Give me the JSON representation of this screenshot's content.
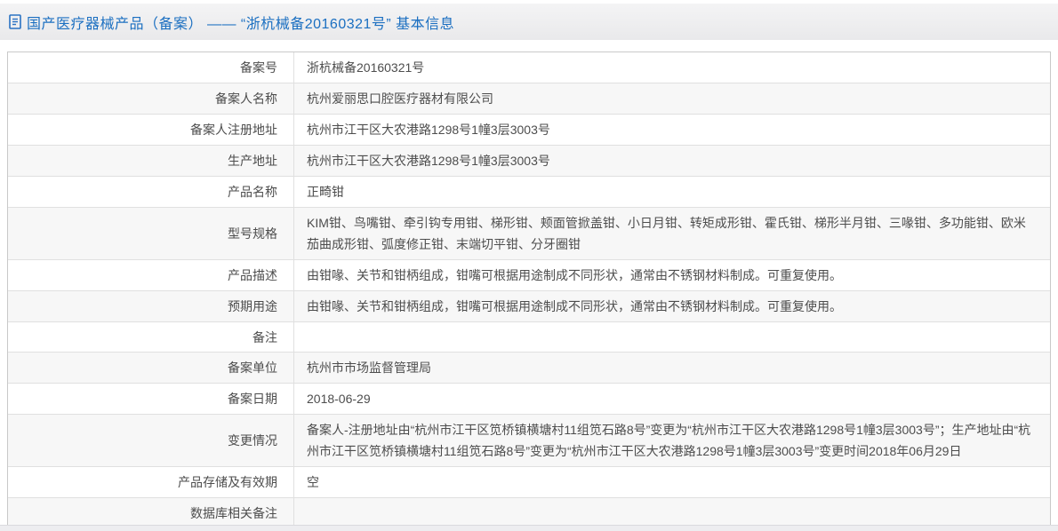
{
  "header": {
    "icon": "document-icon",
    "title": "国产医疗器械产品（备案） —— “浙杭械备20160321号” 基本信息"
  },
  "colors": {
    "title_text": "#1b6fc1",
    "header_bar_bg": "#e9e9eb",
    "table_border": "#c9c9c9",
    "row_divider": "#e0e0e0",
    "row_alt_bg": "#f7f7f7",
    "body_text": "#4d4d4d",
    "footer_bar_bg": "#ededf0"
  },
  "table": {
    "rows": [
      {
        "label": "备案号",
        "value": "浙杭械备20160321号"
      },
      {
        "label": "备案人名称",
        "value": "杭州爱丽思口腔医疗器材有限公司"
      },
      {
        "label": "备案人注册地址",
        "value": "杭州市江干区大农港路1298号1幢3层3003号"
      },
      {
        "label": "生产地址",
        "value": "杭州市江干区大农港路1298号1幢3层3003号"
      },
      {
        "label": "产品名称",
        "value": "正畸钳"
      },
      {
        "label": "型号规格",
        "value": "KIM钳、鸟嘴钳、牵引钩专用钳、梯形钳、颊面管掀盖钳、小日月钳、转矩成形钳、霍氏钳、梯形半月钳、三喙钳、多功能钳、欧米茄曲成形钳、弧度修正钳、末端切平钳、分牙圈钳"
      },
      {
        "label": "产品描述",
        "value": "由钳喙、关节和钳柄组成，钳嘴可根据用途制成不同形状，通常由不锈钢材料制成。可重复使用。"
      },
      {
        "label": "预期用途",
        "value": "由钳喙、关节和钳柄组成，钳嘴可根据用途制成不同形状，通常由不锈钢材料制成。可重复使用。"
      },
      {
        "label": "备注",
        "value": ""
      },
      {
        "label": "备案单位",
        "value": "杭州市市场监督管理局"
      },
      {
        "label": "备案日期",
        "value": "2018-06-29"
      },
      {
        "label": "变更情况",
        "value": "备案人-注册地址由“杭州市江干区笕桥镇横塘村11组笕石路8号”变更为“杭州市江干区大农港路1298号1幢3层3003号”；生产地址由“杭州市江干区笕桥镇横塘村11组笕石路8号”变更为“杭州市江干区大农港路1298号1幢3层3003号”变更时间2018年06月29日"
      },
      {
        "label": "产品存储及有效期",
        "value": "空"
      },
      {
        "label": "数据库相关备注",
        "value": ""
      }
    ]
  }
}
